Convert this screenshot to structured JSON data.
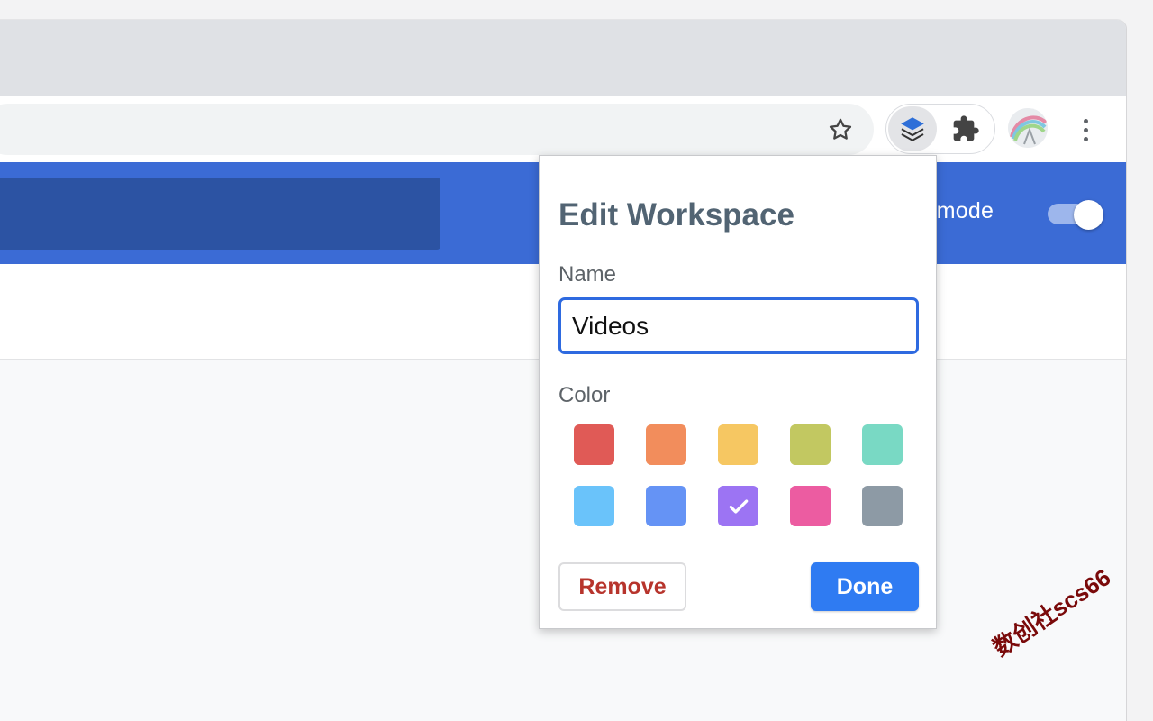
{
  "browser": {
    "extensions": [
      "layers-icon",
      "puzzle-icon"
    ],
    "accent": "#3b6bd5"
  },
  "page": {
    "mode_label": "er mode",
    "mode_toggle_on": true
  },
  "popup": {
    "title": "Edit Workspace",
    "name_label": "Name",
    "name_value": "Videos",
    "color_label": "Color",
    "colors": [
      {
        "hex": "#e05a56",
        "selected": false
      },
      {
        "hex": "#f28d5c",
        "selected": false
      },
      {
        "hex": "#f6c762",
        "selected": false
      },
      {
        "hex": "#c2c861",
        "selected": false
      },
      {
        "hex": "#79d9c4",
        "selected": false
      },
      {
        "hex": "#6ac3fa",
        "selected": false
      },
      {
        "hex": "#6593f5",
        "selected": false
      },
      {
        "hex": "#9c74f3",
        "selected": true
      },
      {
        "hex": "#ec5ca1",
        "selected": false
      },
      {
        "hex": "#8d9aa5",
        "selected": false
      }
    ],
    "remove_label": "Remove",
    "done_label": "Done"
  },
  "watermark": "数创社scs66"
}
